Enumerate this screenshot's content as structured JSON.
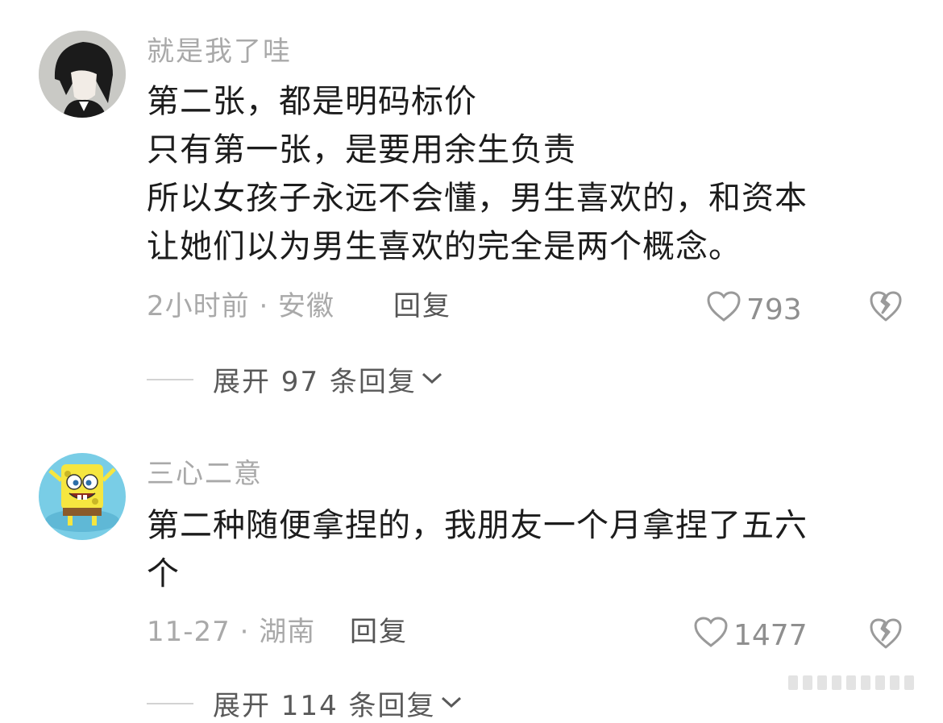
{
  "comments": [
    {
      "username": "就是我了哇",
      "lines": [
        "第二张，都是明码标价",
        "只有第一张，是要用余生负责",
        "所以女孩子永远不会懂，男生喜欢的，和资本",
        "让她们以为男生喜欢的完全是两个概念。"
      ],
      "meta": "2小时前 · 安徽",
      "reply_label": "回复",
      "likes": "793",
      "expand_label": "展开 97 条回复"
    },
    {
      "username": "三心二意",
      "lines": [
        "第二种随便拿捏的，我朋友一个月拿捏了五六",
        "个"
      ],
      "meta": "11-27 · 湖南",
      "reply_label": "回复",
      "likes": "1477",
      "expand_label": "展开 114 条回复"
    }
  ],
  "icons": {
    "like": "heart-outline-icon",
    "dislike": "broken-heart-icon",
    "expand": "chevron-down-icon"
  },
  "colors": {
    "username": "#a9a9a9",
    "text": "#1c1c1c",
    "meta": "#a9a9a9"
  }
}
